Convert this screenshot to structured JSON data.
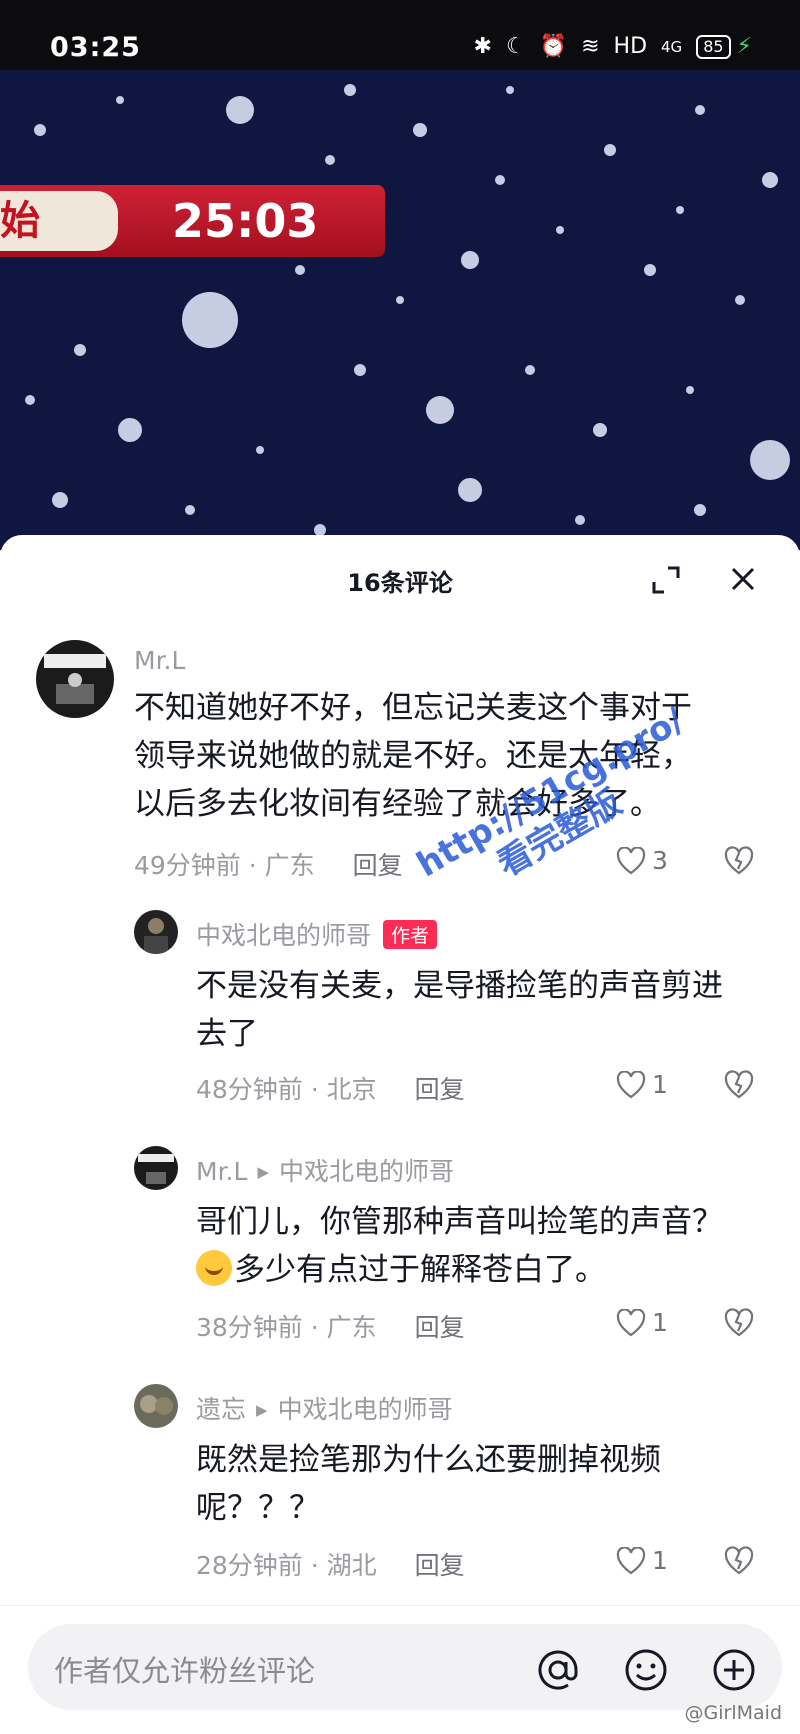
{
  "status_bar": {
    "time": "03:25",
    "battery": "85",
    "network": "HD",
    "signal": "4G"
  },
  "video": {
    "banner_char": "始",
    "timer": "25:03"
  },
  "sheet": {
    "title": "16条评论"
  },
  "comments": [
    {
      "user": "Mr.L",
      "text_line1": "不知道她好不好，但忘记关麦这个事对于",
      "text_line2": "领导来说她做的就是不好。还是太年轻，",
      "text_line3": "以后多去化妆间有经验了就会好多了。",
      "time": "49分钟前 · 广东",
      "reply": "回复",
      "likes": "3"
    },
    {
      "user": "中戏北电的师哥",
      "tag": "作者",
      "text_line1": "不是没有关麦，是导播捡笔的声音剪进",
      "text_line2": "去了",
      "time": "48分钟前 · 北京",
      "reply": "回复",
      "likes": "1"
    },
    {
      "user": "Mr.L",
      "reply_to": "中戏北电的师哥",
      "text_line1": "哥们儿，你管那种声音叫捡笔的声音？",
      "text_line2": "多少有点过于解释苍白了。",
      "time": "38分钟前 · 广东",
      "reply": "回复",
      "likes": "1"
    },
    {
      "user": "遗忘",
      "reply_to": "中戏北电的师哥",
      "text_line1": "既然是捡笔那为什么还要删掉视频",
      "text_line2": "呢？？？",
      "time": "28分钟前 · 湖北",
      "reply": "回复",
      "likes": "1"
    }
  ],
  "input": {
    "placeholder": "作者仅允许粉丝评论"
  },
  "overlay": {
    "url_watermark": "http://51cg.pro/",
    "url_watermark2": "看完整版",
    "corner_watermark": "@GirlMaid"
  },
  "colors": {
    "accent": "#fe2c55",
    "video_bg": "#0f1740",
    "banner_red": "#d02136"
  }
}
